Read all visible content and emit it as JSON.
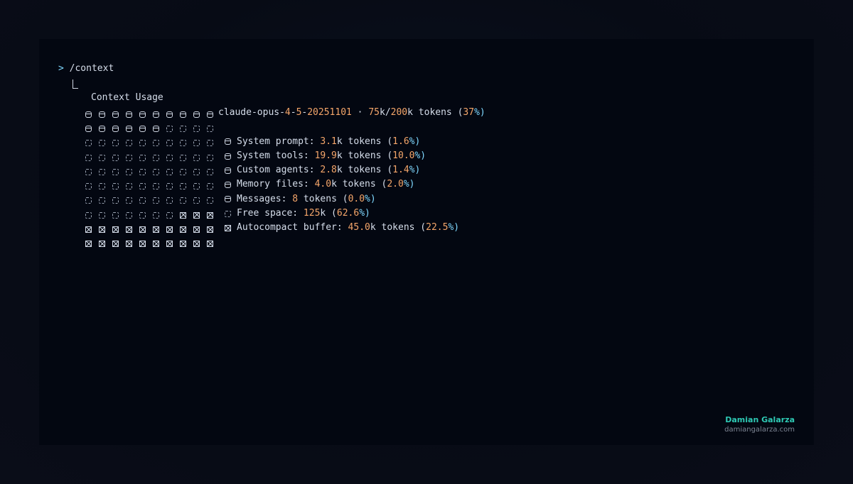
{
  "terminal": {
    "caret": ">",
    "command": "/context",
    "title": "Context Usage",
    "model": {
      "name_parts": [
        "claude-opus-",
        "4",
        "-",
        "5",
        "-",
        "20251101"
      ],
      "separator": " · ",
      "used": "75",
      "used_unit": "k/",
      "total": "200",
      "total_unit": "k tokens (",
      "percent": "37",
      "percent_suffix": "%)"
    },
    "grid_rows": [
      [
        "used",
        "used",
        "used",
        "used",
        "used",
        "used",
        "used",
        "used",
        "used",
        "used"
      ],
      [
        "used",
        "used",
        "used",
        "used",
        "used",
        "used",
        "free",
        "free",
        "free",
        "free"
      ],
      [
        "free",
        "free",
        "free",
        "free",
        "free",
        "free",
        "free",
        "free",
        "free",
        "free"
      ],
      [
        "free",
        "free",
        "free",
        "free",
        "free",
        "free",
        "free",
        "free",
        "free",
        "free"
      ],
      [
        "free",
        "free",
        "free",
        "free",
        "free",
        "free",
        "free",
        "free",
        "free",
        "free"
      ],
      [
        "free",
        "free",
        "free",
        "free",
        "free",
        "free",
        "free",
        "free",
        "free",
        "free"
      ],
      [
        "free",
        "free",
        "free",
        "free",
        "free",
        "free",
        "free",
        "free",
        "free",
        "free"
      ],
      [
        "free",
        "free",
        "free",
        "free",
        "free",
        "free",
        "free",
        "buffer",
        "buffer",
        "buffer"
      ],
      [
        "buffer",
        "buffer",
        "buffer",
        "buffer",
        "buffer",
        "buffer",
        "buffer",
        "buffer",
        "buffer",
        "buffer"
      ],
      [
        "buffer",
        "buffer",
        "buffer",
        "buffer",
        "buffer",
        "buffer",
        "buffer",
        "buffer",
        "buffer",
        "buffer"
      ]
    ],
    "categories": [
      {
        "icon": "used",
        "label": "System prompt: ",
        "value": "3.1",
        "unit": "k tokens (",
        "pct": "1.6",
        "pct_suffix": "%)"
      },
      {
        "icon": "used",
        "label": "System tools: ",
        "value": "19.9",
        "unit": "k tokens (",
        "pct": "10.0",
        "pct_suffix": "%)"
      },
      {
        "icon": "used",
        "label": "Custom agents: ",
        "value": "2.8",
        "unit": "k tokens (",
        "pct": "1.4",
        "pct_suffix": "%)"
      },
      {
        "icon": "used",
        "label": "Memory files: ",
        "value": "4.0",
        "unit": "k tokens (",
        "pct": "2.0",
        "pct_suffix": "%)"
      },
      {
        "icon": "used",
        "label": "Messages: ",
        "value": "8",
        "unit": " tokens (",
        "pct": "0.0",
        "pct_suffix": "%)"
      },
      {
        "icon": "free",
        "label": "Free space: ",
        "value": "125",
        "unit": "k (",
        "pct": "62.6",
        "pct_suffix": "%)"
      },
      {
        "icon": "buffer",
        "label": "Autocompact buffer: ",
        "value": "45.0",
        "unit": "k tokens (",
        "pct": "22.5",
        "pct_suffix": "%)"
      }
    ]
  },
  "brand": {
    "name": "Damian Galarza",
    "url": "damiangalarza.com"
  },
  "colors": {
    "number": "#f5a66a",
    "percent": "#7fd8ff",
    "text": "#d6deeb",
    "brand": "#2ec9b4"
  }
}
